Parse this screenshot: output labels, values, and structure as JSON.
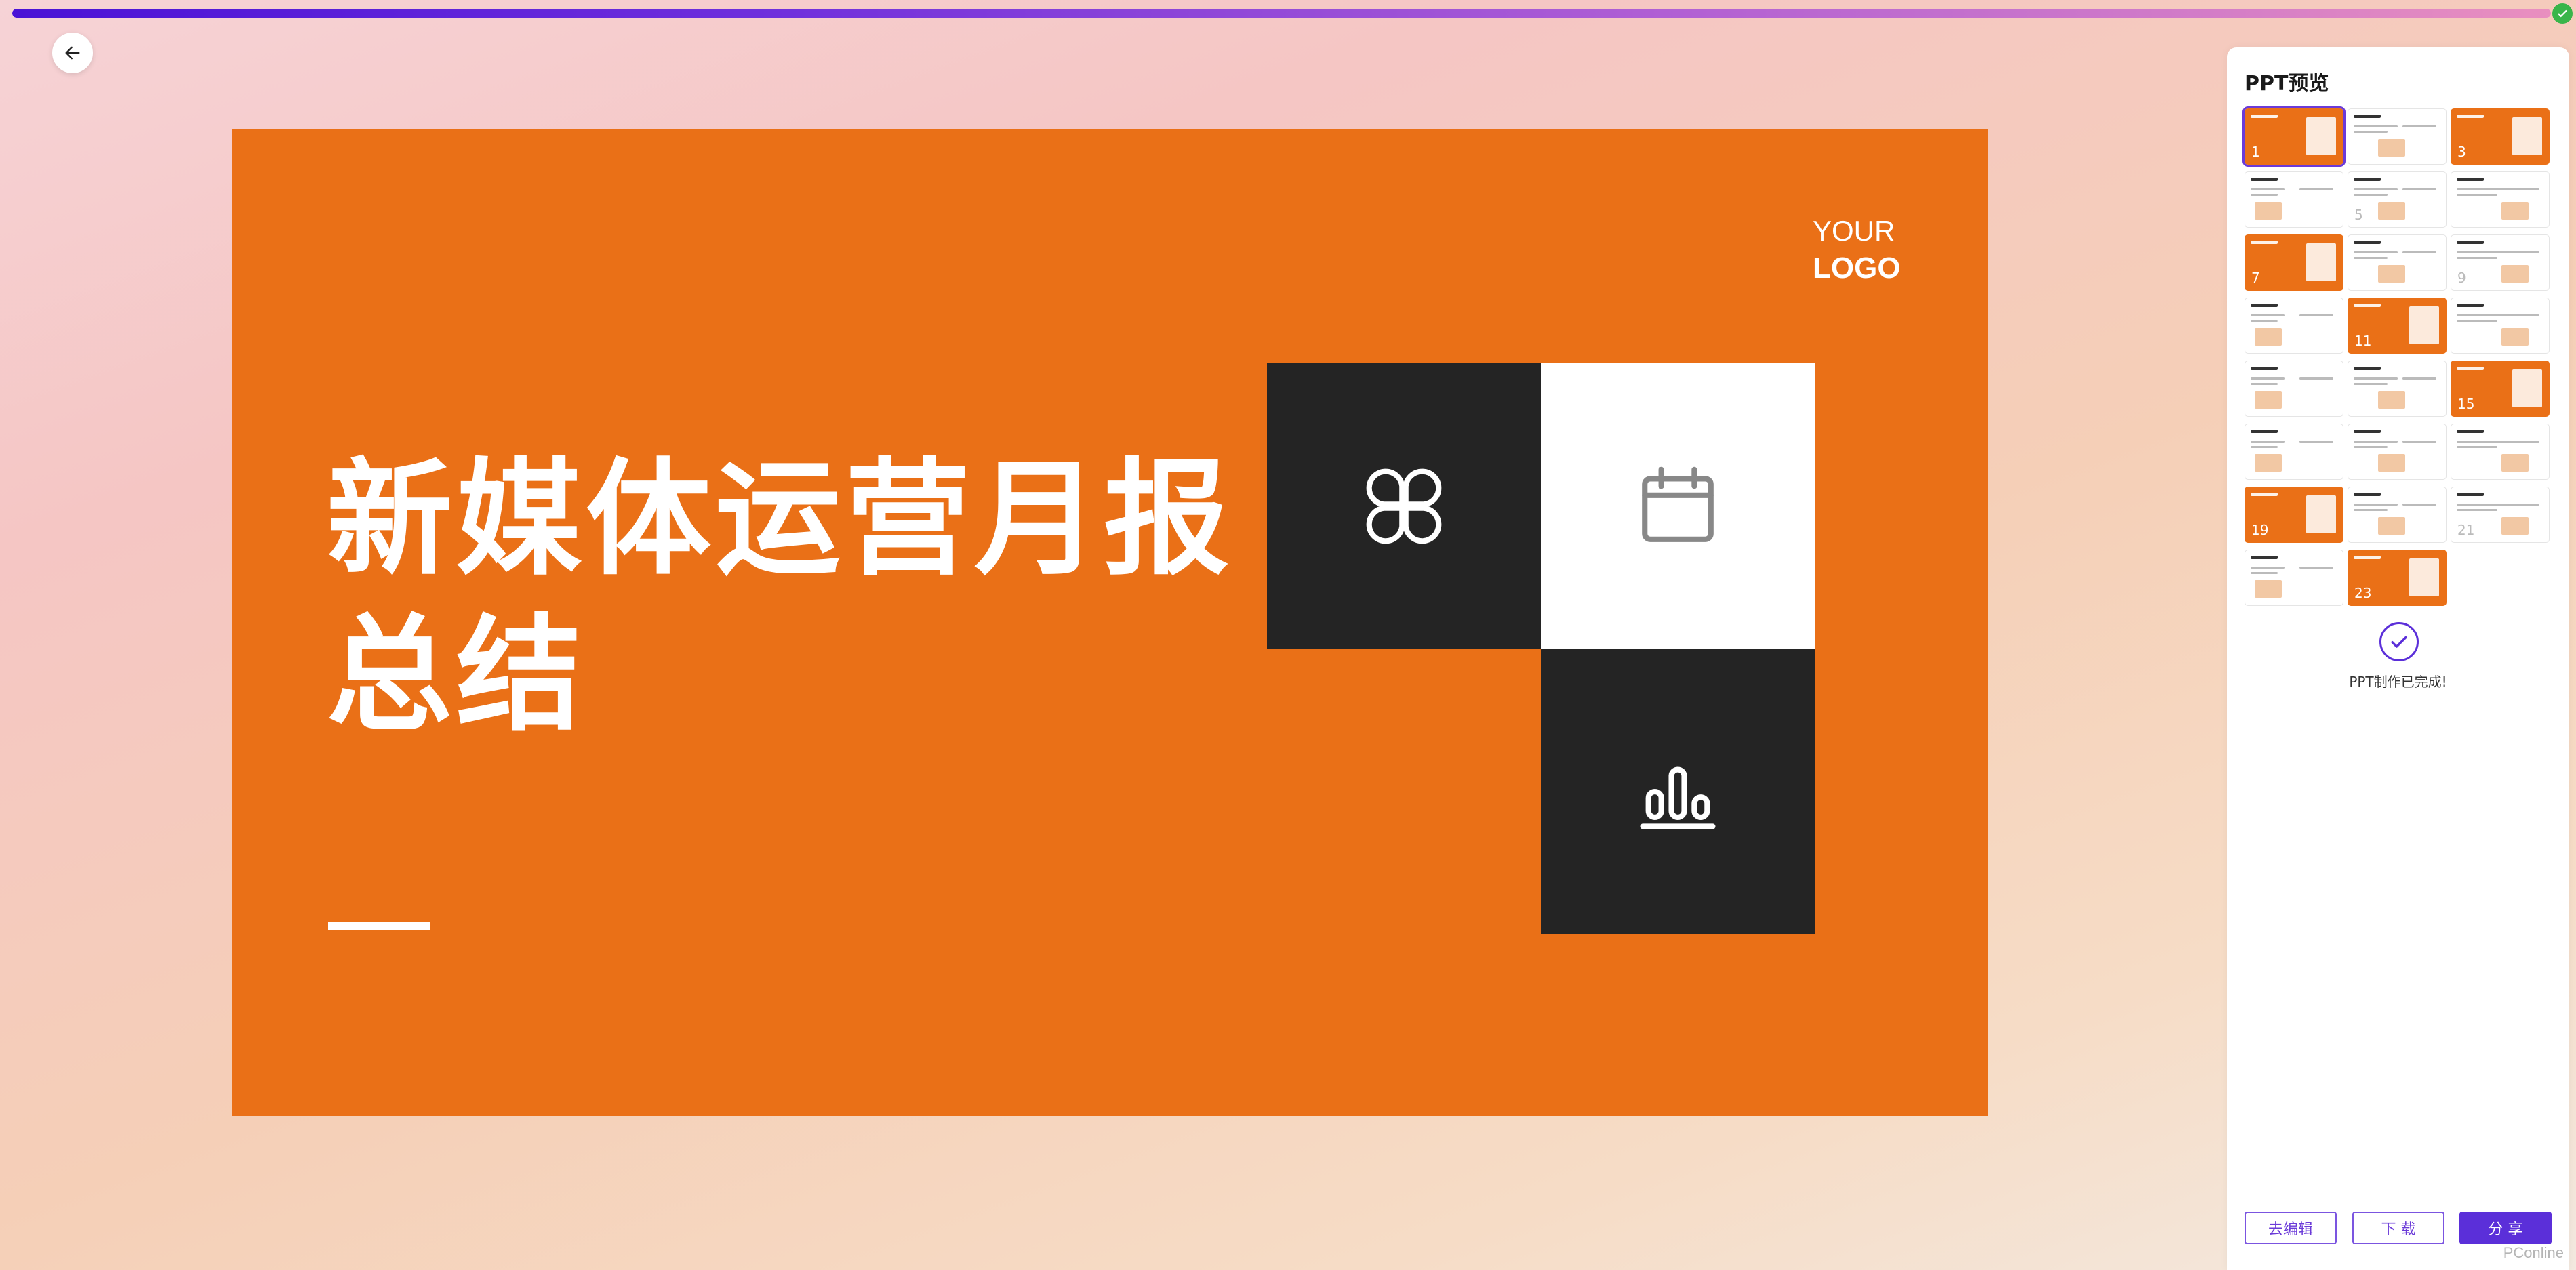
{
  "progress": {
    "value": 1.0
  },
  "colors": {
    "accent": "#5b2fd9",
    "slide_orange": "#ea7017",
    "tile_dark": "#242424"
  },
  "back_icon": "arrow-left-icon",
  "slide": {
    "logo_line1": "YOUR",
    "logo_line2": "LOGO",
    "title": "新媒体运营月报总结",
    "tiles": [
      {
        "icon": "apps-grid-icon",
        "theme": "dark"
      },
      {
        "icon": "calendar-icon",
        "theme": "light"
      },
      {
        "icon": "bar-chart-icon",
        "theme": "dark"
      }
    ]
  },
  "panel": {
    "title": "PPT预览",
    "thumbnails": [
      {
        "number": "1",
        "style": "orange",
        "selected": true
      },
      {
        "number": "",
        "style": "light"
      },
      {
        "number": "3",
        "style": "orange"
      },
      {
        "number": "",
        "style": "light"
      },
      {
        "number": "5",
        "style": "light"
      },
      {
        "number": "",
        "style": "light"
      },
      {
        "number": "7",
        "style": "orange"
      },
      {
        "number": "",
        "style": "light"
      },
      {
        "number": "9",
        "style": "light"
      },
      {
        "number": "",
        "style": "light"
      },
      {
        "number": "11",
        "style": "orange"
      },
      {
        "number": "",
        "style": "light"
      },
      {
        "number": "",
        "style": "light"
      },
      {
        "number": "",
        "style": "light"
      },
      {
        "number": "15",
        "style": "orange"
      },
      {
        "number": "",
        "style": "light"
      },
      {
        "number": "",
        "style": "light"
      },
      {
        "number": "",
        "style": "light"
      },
      {
        "number": "19",
        "style": "orange"
      },
      {
        "number": "",
        "style": "light"
      },
      {
        "number": "21",
        "style": "light"
      },
      {
        "number": "",
        "style": "light"
      },
      {
        "number": "23",
        "style": "orange"
      }
    ],
    "done_text": "PPT制作已完成!",
    "buttons": {
      "edit": "去编辑",
      "download": "下 载",
      "share": "分 享"
    }
  },
  "watermark": "PConline"
}
